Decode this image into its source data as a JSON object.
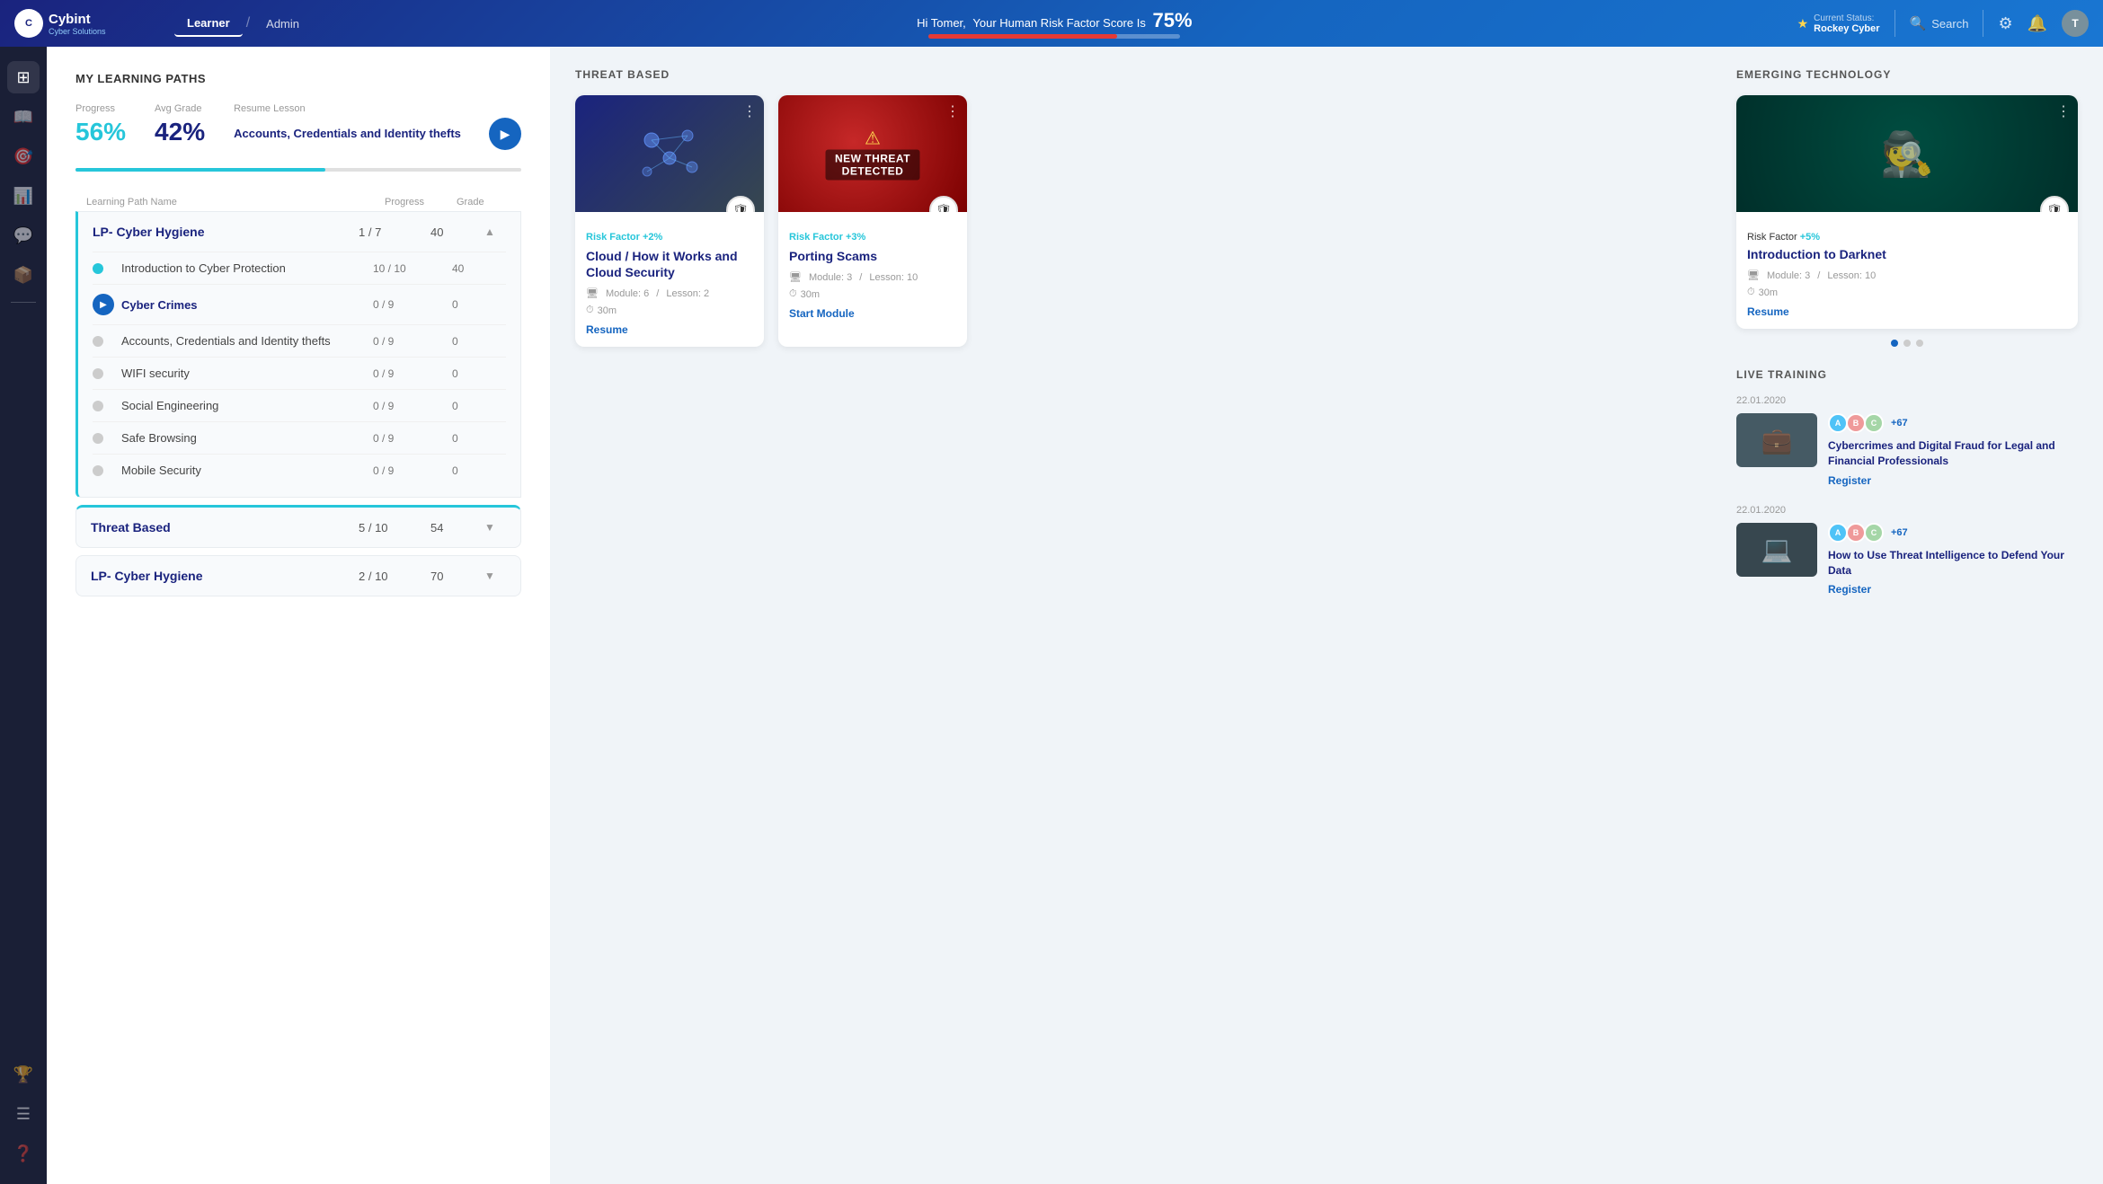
{
  "topnav": {
    "logo": "Cybint",
    "logo_sub": "Cyber Solutions",
    "tabs": [
      "Learner",
      "Admin"
    ],
    "active_tab": "Learner",
    "greeting": "Hi Tomer,",
    "risk_label": "Your Human Risk Factor Score Is",
    "risk_score": "75%",
    "current_status_label": "Current Status:",
    "current_status_value": "Rockey Cyber",
    "search_placeholder": "Search"
  },
  "sidebar": {
    "icons": [
      "grid",
      "book",
      "target",
      "bell",
      "chat",
      "box",
      "info",
      "award",
      "list"
    ]
  },
  "learning_paths": {
    "section_title": "MY LEARNING PATHS",
    "progress_label": "Progress",
    "avg_grade_label": "Avg Grade",
    "resume_lesson_label": "Resume Lesson",
    "progress_value": "56%",
    "avg_grade_value": "42%",
    "resume_lesson_text": "Accounts, Credentials and Identity thefts",
    "table_headers": [
      "Learning Path Name",
      "Progress",
      "Grade"
    ],
    "paths": [
      {
        "name": "LP- Cyber Hygiene",
        "progress": "1 / 7",
        "grade": "40",
        "expanded": true,
        "border_color": "#26c6da",
        "lessons": [
          {
            "name": "Introduction to Cyber Protection",
            "progress": "10 / 10",
            "grade": "40",
            "status": "done"
          },
          {
            "name": "Cyber Crimes",
            "progress": "0 / 9",
            "grade": "0",
            "status": "active"
          },
          {
            "name": "Accounts, Credentials and Identity thefts",
            "progress": "0 / 9",
            "grade": "0",
            "status": "pending"
          },
          {
            "name": "WIFI security",
            "progress": "0 / 9",
            "grade": "0",
            "status": "pending"
          },
          {
            "name": "Social Engineering",
            "progress": "0 / 9",
            "grade": "0",
            "status": "pending"
          },
          {
            "name": "Safe Browsing",
            "progress": "0 / 9",
            "grade": "0",
            "status": "pending"
          },
          {
            "name": "Mobile Security",
            "progress": "0 / 9",
            "grade": "0",
            "status": "pending"
          }
        ]
      },
      {
        "name": "Threat Based",
        "progress": "5 / 10",
        "grade": "54",
        "expanded": false,
        "border_color": "#26c6da"
      },
      {
        "name": "LP- Cyber Hygiene",
        "progress": "2 / 10",
        "grade": "70",
        "expanded": false,
        "border_color": "#26c6da"
      }
    ]
  },
  "threat_based": {
    "section_title": "THREAT BASED",
    "cards": [
      {
        "thumb_type": "dark",
        "risk_label": "Risk Factor",
        "risk_value": "+2%",
        "risk_color": "teal",
        "title": "Cloud / How it Works and Cloud Security",
        "module": "6",
        "lesson": "2",
        "time": "30m",
        "action": "Resume",
        "new_threat": false
      },
      {
        "thumb_type": "red",
        "risk_label": "Risk Factor",
        "risk_value": "+3%",
        "risk_color": "teal",
        "title": "Porting Scams",
        "module": "3",
        "lesson": "10",
        "time": "30m",
        "action": "Start Module",
        "new_threat": true
      }
    ]
  },
  "emerging_technology": {
    "section_title": "EMERGING TECHNOLOGY",
    "cards": [
      {
        "thumb_type": "teal",
        "risk_label": "Risk Factor",
        "risk_value": "+5%",
        "risk_color": "teal",
        "title": "Introduction to Darknet",
        "module": "3",
        "lesson": "10",
        "time": "30m",
        "action": "Resume"
      }
    ],
    "dot_nav": [
      1,
      2,
      3
    ]
  },
  "live_training": {
    "section_title": "LIVE TRAINING",
    "trainings": [
      {
        "date": "22.01.2020",
        "title": "Cybercrimes and Digital Fraud for Legal and Financial Professionals",
        "register_label": "Register",
        "plus_count": "+67"
      },
      {
        "date": "22.01.2020",
        "title": "How to Use Threat Intelligence to Defend Your Data",
        "register_label": "Register",
        "plus_count": "+67"
      }
    ]
  }
}
